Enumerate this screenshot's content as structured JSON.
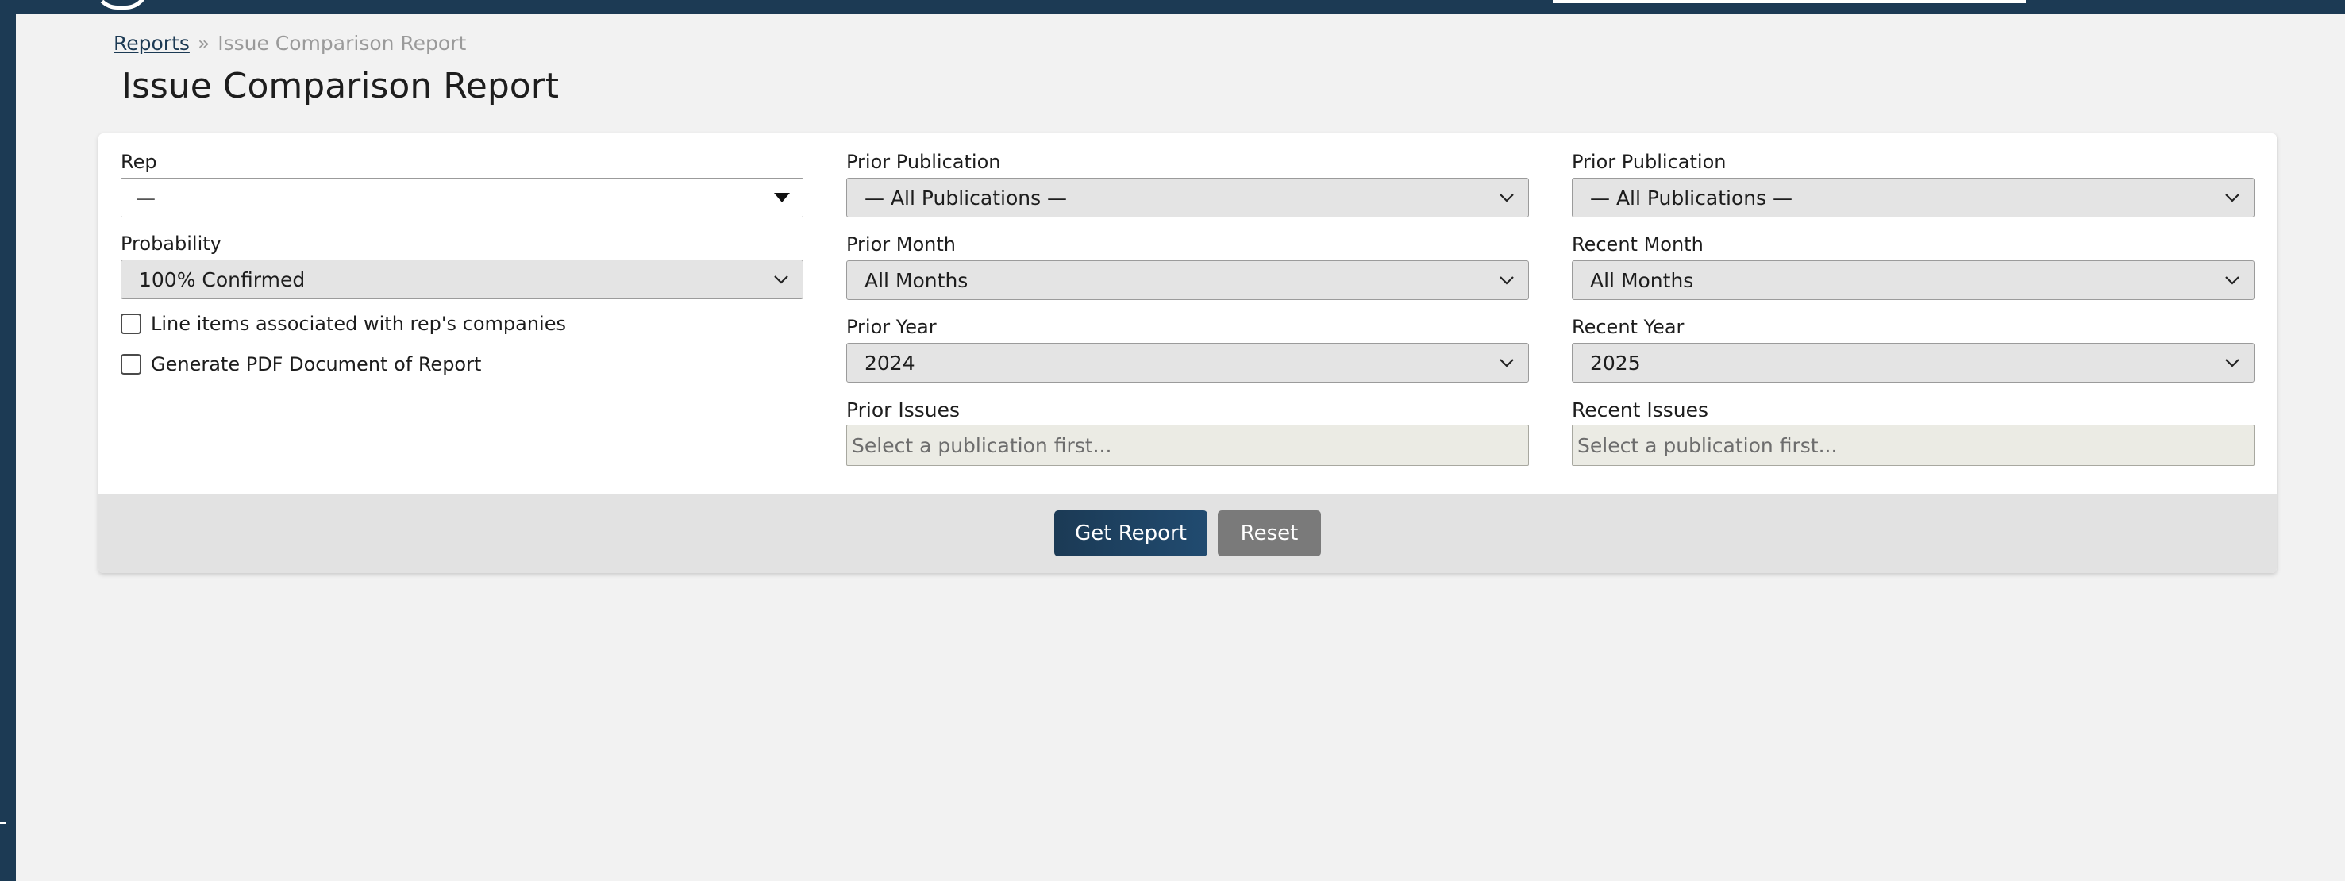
{
  "breadcrumb": {
    "parent": "Reports",
    "separator": "»",
    "current": "Issue Comparison Report"
  },
  "page": {
    "title": "Issue Comparison Report"
  },
  "form": {
    "rep": {
      "label": "Rep",
      "value": "—"
    },
    "probability": {
      "label": "Probability",
      "value": "100% Confirmed"
    },
    "checkboxes": [
      {
        "label": "Line items associated with rep's companies",
        "checked": false
      },
      {
        "label": "Generate PDF Document of Report",
        "checked": false
      }
    ],
    "prior_publication": {
      "label": "Prior Publication",
      "value": "— All Publications —"
    },
    "prior_month": {
      "label": "Prior Month",
      "value": "All Months"
    },
    "prior_year": {
      "label": "Prior Year",
      "value": "2024"
    },
    "prior_issues": {
      "label": "Prior Issues",
      "placeholder": "Select a publication first..."
    },
    "recent_publication": {
      "label": "Prior Publication",
      "value": "— All Publications —"
    },
    "recent_month": {
      "label": "Recent Month",
      "value": "All Months"
    },
    "recent_year": {
      "label": "Recent Year",
      "value": "2025"
    },
    "recent_issues": {
      "label": "Recent Issues",
      "placeholder": "Select a publication first..."
    }
  },
  "actions": {
    "get_report": "Get Report",
    "reset": "Reset"
  },
  "colors": {
    "nav": "#1c3a54",
    "primary_button": "#1b3a55",
    "secondary_button": "#7a7a7a"
  }
}
